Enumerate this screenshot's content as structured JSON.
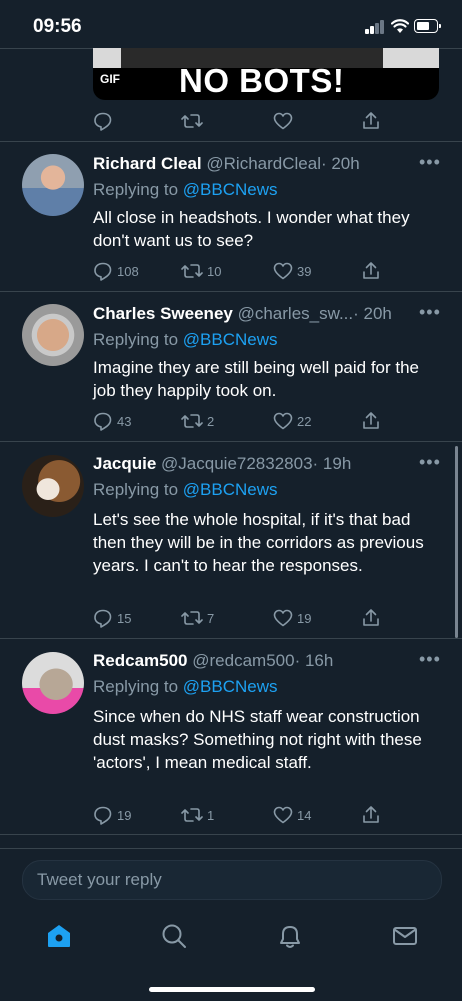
{
  "status_bar": {
    "time": "09:56"
  },
  "gif_card": {
    "badge": "GIF",
    "caption": "NO BOTS!"
  },
  "tweets": [
    {
      "name": "Richard Cleal",
      "handle": "@RichardCleal",
      "time": "· 20h",
      "replying_prefix": "Replying to ",
      "replying_to": "@BBCNews",
      "text": "All close in headshots. I wonder what they don't want us to see?",
      "replies": "108",
      "retweets": "10",
      "likes": "39"
    },
    {
      "name": "Charles Sweeney",
      "handle": "@charles_sw...",
      "time": "· 20h",
      "replying_prefix": "Replying to ",
      "replying_to": "@BBCNews",
      "text": "Imagine they are still being well paid for the job they happily took on.",
      "replies": "43",
      "retweets": "2",
      "likes": "22"
    },
    {
      "name": "Jacquie",
      "handle": "@Jacquie72832803",
      "time": "· 19h",
      "replying_prefix": "Replying to ",
      "replying_to": "@BBCNews",
      "text": "Let's see the whole hospital, if it's  that bad then they will be in the corridors as previous years. I can't to hear the responses.",
      "replies": "15",
      "retweets": "7",
      "likes": "19"
    },
    {
      "name": "Redcam500",
      "handle": "@redcam500",
      "time": "· 16h",
      "replying_prefix": "Replying to ",
      "replying_to": "@BBCNews",
      "text": "Since when do NHS staff wear construction dust masks? Something not right with these 'actors', I mean medical staff.",
      "replies": "19",
      "retweets": "1",
      "likes": "14"
    }
  ],
  "compose": {
    "placeholder": "Tweet your reply"
  },
  "nav": {
    "active": "home",
    "items": [
      "home-icon",
      "search-icon",
      "notifications-icon",
      "messages-icon"
    ]
  },
  "colors": {
    "background": "#15202b",
    "accent": "#1da1f2",
    "muted": "#8899a6",
    "divider": "#38444d"
  }
}
